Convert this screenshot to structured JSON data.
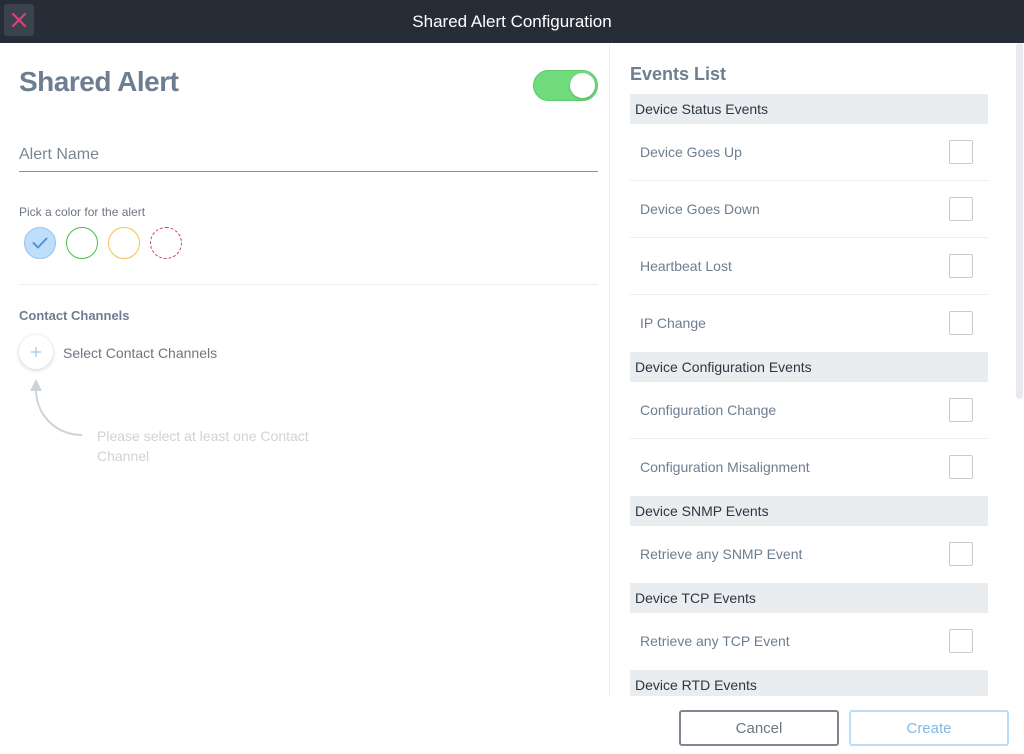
{
  "window": {
    "title": "Shared Alert Configuration",
    "close_icon": "close-icon"
  },
  "left": {
    "heading": "Shared Alert",
    "toggle_on": true,
    "alert_name_placeholder": "Alert Name",
    "alert_name_value": "",
    "color_label": "Pick a color for the alert",
    "colors": [
      {
        "name": "blue",
        "hex": "#bfdefa",
        "selected": true
      },
      {
        "name": "green",
        "hex": "#41c048",
        "selected": false
      },
      {
        "name": "yellow",
        "hex": "#f5c24a",
        "selected": false
      },
      {
        "name": "pink",
        "hex": "#c8406a",
        "selected": false
      }
    ],
    "contact_channels_label": "Contact Channels",
    "select_channels_label": "Select Contact Channels",
    "hint": "Please select at least one Contact Channel"
  },
  "events": {
    "title": "Events List",
    "categories": [
      {
        "name": "Device Status Events",
        "items": [
          "Device Goes Up",
          "Device Goes Down",
          "Heartbeat Lost",
          "IP Change"
        ]
      },
      {
        "name": "Device Configuration Events",
        "items": [
          "Configuration Change",
          "Configuration Misalignment"
        ]
      },
      {
        "name": "Device SNMP Events",
        "items": [
          "Retrieve any SNMP Event"
        ]
      },
      {
        "name": "Device TCP Events",
        "items": [
          "Retrieve any TCP Event"
        ]
      },
      {
        "name": "Device RTD Events",
        "items": []
      }
    ]
  },
  "footer": {
    "cancel_label": "Cancel",
    "create_label": "Create"
  },
  "colors": {
    "titlebar": "#262d36",
    "toggle": "#6fdb7c",
    "close_x": "#e0407a",
    "accent": "#7fb9e8"
  }
}
